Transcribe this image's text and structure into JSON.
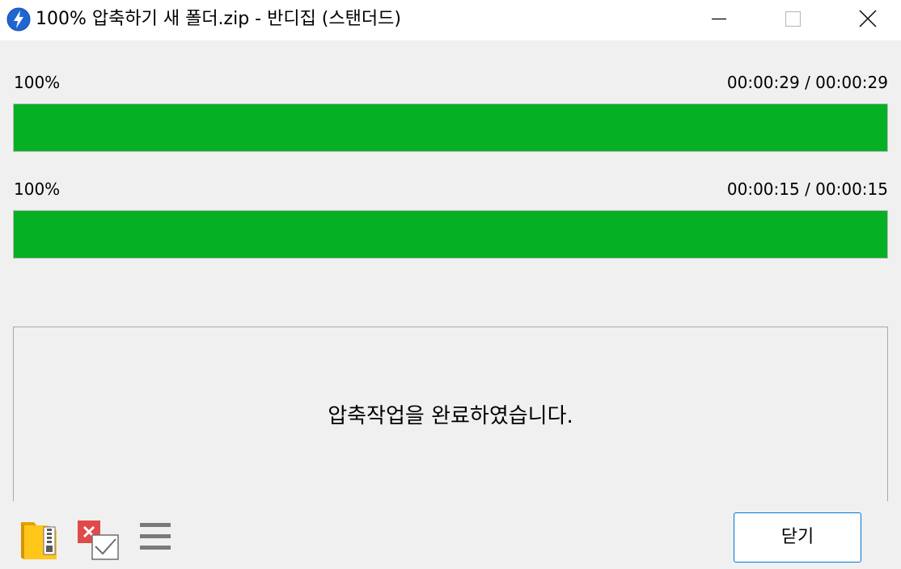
{
  "window": {
    "title": "100% 압축하기 새 폴더.zip - 반디집 (스탠더드)",
    "app_icon": "bandizip-lightning-icon",
    "controls": {
      "minimize_icon": "minimize-icon",
      "maximize_icon": "maximize-icon",
      "close_icon": "close-icon"
    }
  },
  "progress": [
    {
      "percent_label": "100%",
      "time_label": "00:00:29 / 00:00:29",
      "value": 1.0
    },
    {
      "percent_label": "100%",
      "time_label": "00:00:15 / 00:00:15",
      "value": 1.0
    }
  ],
  "message": "압축작업을 완료하였습니다.",
  "toolbar": {
    "icons": [
      "open-folder-zip-icon",
      "delete-check-icon",
      "menu-icon"
    ]
  },
  "footer": {
    "close_label": "닫기"
  },
  "colors": {
    "progress_fill": "#06b025",
    "accent": "#0078d7",
    "background": "#f0f0f0"
  }
}
